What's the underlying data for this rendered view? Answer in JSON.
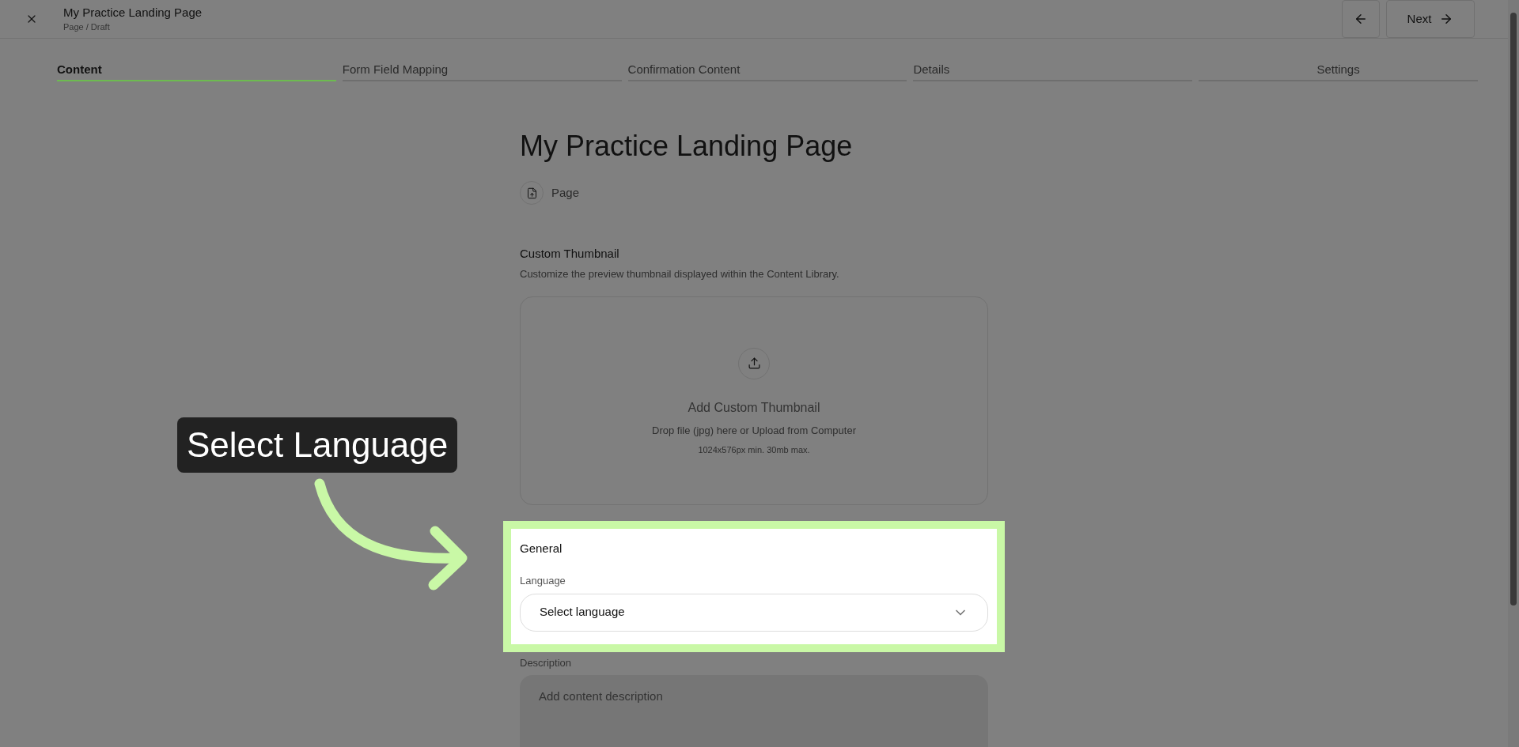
{
  "header": {
    "title": "My Practice Landing Page",
    "subtitle": "Page / Draft",
    "next": "Next"
  },
  "tabs": [
    {
      "label": "Content",
      "selected": true
    },
    {
      "label": "Form Field Mapping",
      "selected": false
    },
    {
      "label": "Confirmation Content",
      "selected": false
    },
    {
      "label": "Details",
      "selected": false
    },
    {
      "label": "Settings",
      "selected": false
    }
  ],
  "content": {
    "title": "My Practice Landing Page",
    "type_label": "Page",
    "thumbnail": {
      "heading": "Custom Thumbnail",
      "description": "Customize the preview thumbnail displayed within the Content Library.",
      "drop_title": "Add Custom Thumbnail",
      "drop_hint": "Drop file (jpg) here or Upload from Computer",
      "limits": "1024x576px min. 30mb max."
    },
    "general": {
      "heading": "General",
      "highlighted": true,
      "language_label": "Language",
      "language_placeholder": "Select language"
    },
    "description": {
      "label": "Description",
      "placeholder": "Add content description"
    }
  },
  "callout": {
    "text": "Select Language"
  }
}
